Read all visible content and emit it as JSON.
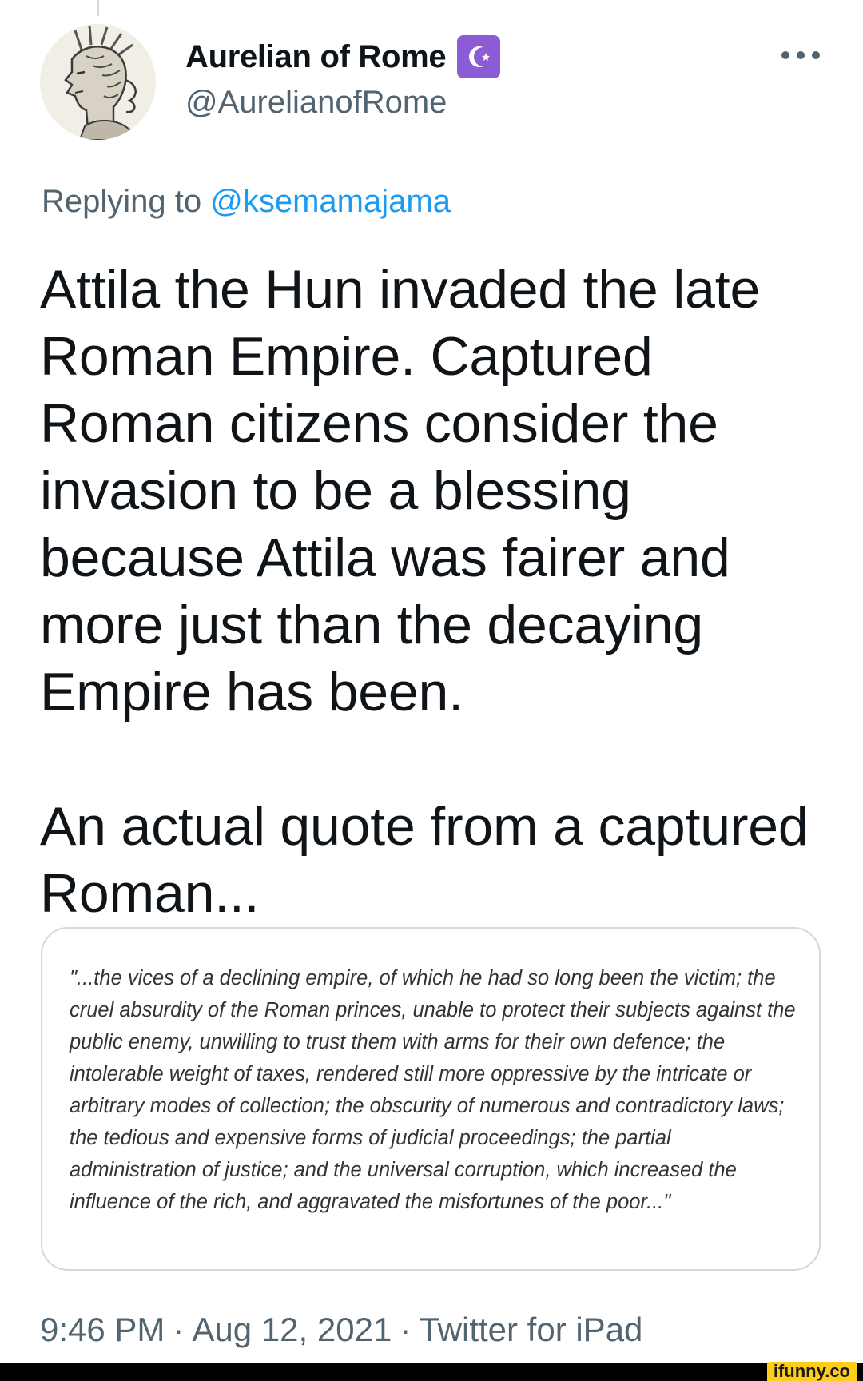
{
  "tweet": {
    "author": {
      "display_name": "Aurelian of Rome",
      "handle": "@AurelianofRome",
      "badge_icon": "crescent-star-icon",
      "badge_color": "#8b5cd6"
    },
    "reply": {
      "prefix": "Replying to",
      "mention": "@ksemamajama"
    },
    "text_paragraphs": [
      "Attila the Hun invaded the late Roman Empire. Captured Roman citizens consider the invasion to be a blessing because Attila was fairer and more just than the decaying Empire has been.",
      "An actual quote from a captured Roman..."
    ],
    "quote_image_text": "\"...the vices of a declining empire, of which he had so long been the victim; the cruel absurdity of the Roman princes, unable to protect their subjects against the public enemy, unwilling to trust them with arms for their own defence; the intolerable weight of taxes, rendered still more oppressive by the intricate or arbitrary modes of collection; the obscurity of numerous and contradictory laws; the tedious and expensive forms of judicial proceedings; the partial administration of justice; and the universal corruption, which increased the influence of the rich, and aggravated the misfortunes of the poor...\"",
    "meta": {
      "time": "9:46 PM",
      "date": "Aug 12, 2021",
      "source": "Twitter for iPad",
      "separator": "·"
    }
  },
  "watermark": "ifunny.co",
  "colors": {
    "link": "#1d9bf0",
    "secondary_text": "#536471",
    "primary_text": "#0f1419",
    "border": "#cfd9de"
  }
}
